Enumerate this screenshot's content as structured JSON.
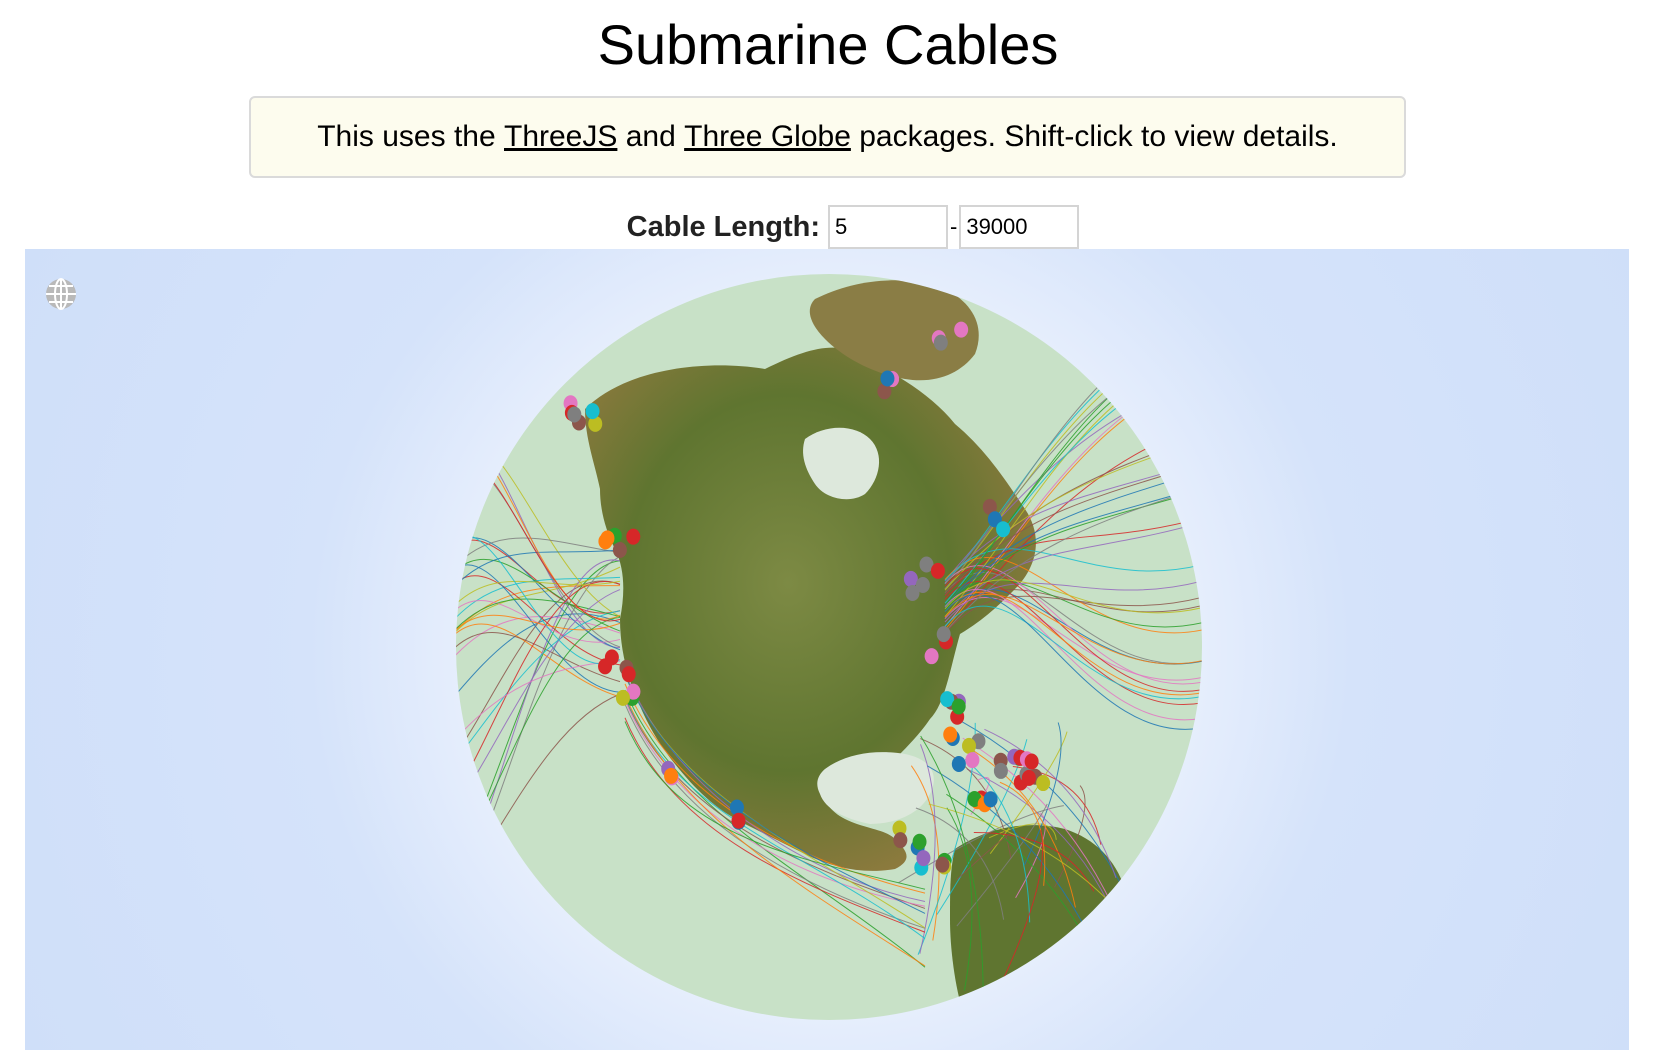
{
  "page": {
    "title": "Submarine Cables"
  },
  "notice": {
    "prefix": "This uses the ",
    "link1": "ThreeJS",
    "middle": " and ",
    "link2": "Three Globe",
    "suffix": " packages. Shift-click to view details."
  },
  "filter": {
    "label": "Cable Length:",
    "min_value": "5",
    "separator": "-",
    "max_value": "39000"
  },
  "globe": {
    "toggle_icon": "globe-icon",
    "colors": {
      "ocean": "#c8e1c7",
      "background": "#d5e3fa",
      "land": "#6b7a3a",
      "ice": "#e8f1e6"
    },
    "cable_colors": [
      "#1f77b4",
      "#ff7f0e",
      "#2ca02c",
      "#d62728",
      "#9467bd",
      "#8c564b",
      "#e377c2",
      "#7f7f7f",
      "#bcbd22",
      "#17becf"
    ]
  }
}
